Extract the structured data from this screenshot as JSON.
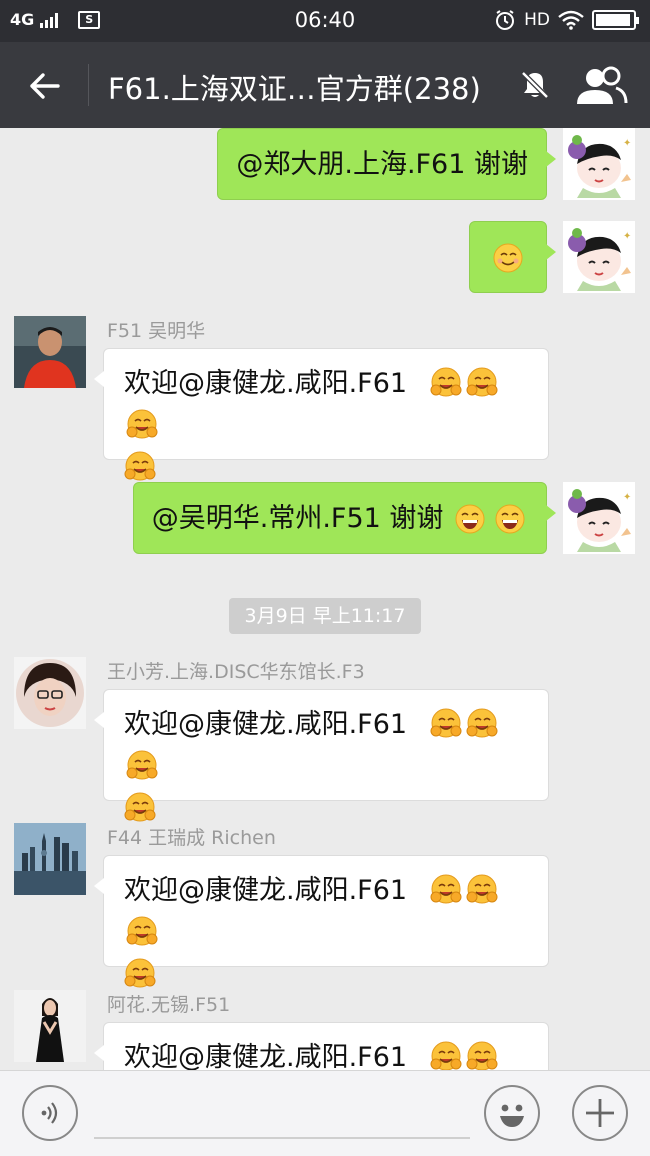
{
  "status": {
    "network": "4G",
    "time": "06:40",
    "hd": "HD",
    "battery_fraction": 0.95
  },
  "header": {
    "title": "F61.上海双证…官方群(238)",
    "icons": [
      "back-arrow-icon",
      "mute-icon",
      "group-members-icon"
    ]
  },
  "messages": [
    {
      "side": "me",
      "text": "@郑大朋.上海.F61  谢谢",
      "avatar": "cartoon-girl-avatar"
    },
    {
      "side": "me",
      "emoji": "smile-emoji",
      "avatar": "cartoon-girl-avatar"
    },
    {
      "side": "other",
      "sender": "F51 吴明华",
      "line1": "欢迎@康健龙.咸阳.F61",
      "emoji": "grin-hands-emoji"
    },
    {
      "side": "me",
      "text": "@吴明华.常州.F51  谢谢",
      "emoji": "laughing-emoji",
      "avatar": "cartoon-girl-avatar"
    },
    {
      "side": "other",
      "sender": "王小芳.上海.DISC华东馆长.F3",
      "line1": "欢迎@康健龙.咸阳.F61",
      "emoji": "grin-hands-emoji"
    },
    {
      "side": "other",
      "sender": "F44 王瑞成 Richen",
      "line1": "欢迎@康健龙.咸阳.F61",
      "emoji": "grin-hands-emoji"
    },
    {
      "side": "other",
      "sender": "阿花.无锡.F51",
      "line1": "欢迎@康健龙.咸阳.F61",
      "emoji": "grin-hands-emoji"
    }
  ],
  "timestamp": "3月9日 早上11:17",
  "input": {
    "icons": [
      "voice-icon",
      "emoji-icon",
      "plus-icon"
    ]
  },
  "colors": {
    "status_bg": "#2d2e33",
    "nav_bg": "#393a3f",
    "chat_bg": "#ebebeb",
    "my_bubble": "#9fe658",
    "other_bubble": "#ffffff"
  }
}
